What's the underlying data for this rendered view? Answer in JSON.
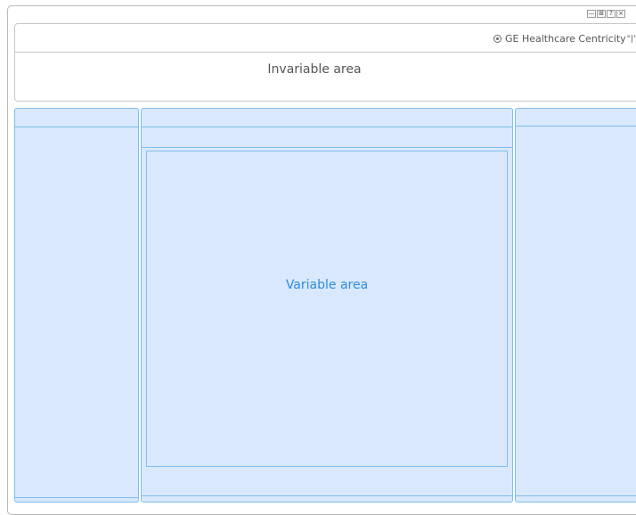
{
  "window": {
    "controls": [
      "—",
      "⊞",
      "?",
      "×"
    ]
  },
  "header": {
    "brand_text": "GE Healthcare Centricity",
    "brand_suffix": "°|'"
  },
  "invariable_area": {
    "label": "Invariable area"
  },
  "variable_area": {
    "label": "Variable area"
  },
  "colors": {
    "panel_fill": "#d9e8fc",
    "panel_border": "#7fbdf0",
    "variable_text": "#2d8ce0",
    "invariable_text": "#555555"
  }
}
